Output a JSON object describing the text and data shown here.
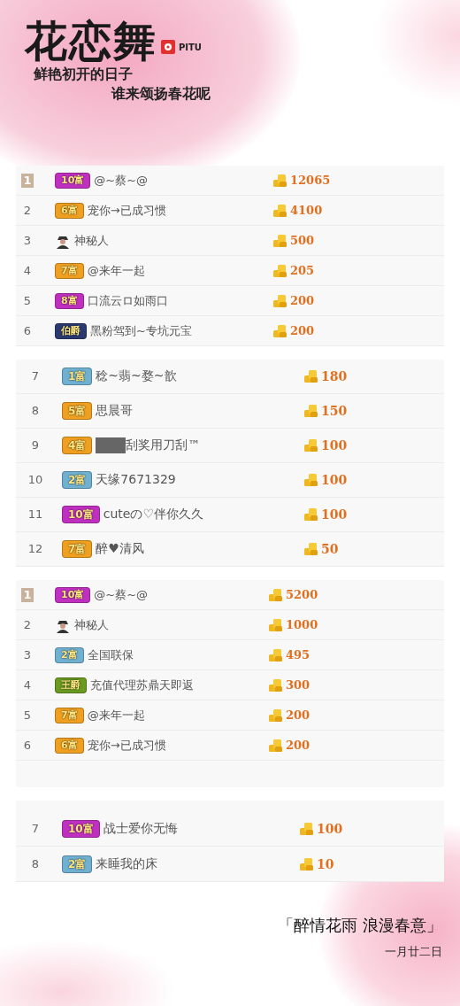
{
  "header": {
    "title": "花恋舞",
    "brand": "PITU",
    "subtitle_lines": [
      "鲜艳初开的日子",
      "谁来颂扬春花呢"
    ]
  },
  "panels": [
    {
      "rows": [
        {
          "rank": "1",
          "top": true,
          "kind": "badge",
          "badge": "10富",
          "color": "#c030c0",
          "redacted": false,
          "name": "@~蔡~@",
          "amount": "12065"
        },
        {
          "rank": "2",
          "top": false,
          "kind": "badge",
          "badge": "6富",
          "color": "#f0a020",
          "redacted": false,
          "name": "宠你→已成习惯",
          "amount": "4100"
        },
        {
          "rank": "3",
          "top": false,
          "kind": "anonymous",
          "redacted": false,
          "name": "神秘人",
          "amount": "500"
        },
        {
          "rank": "4",
          "top": false,
          "kind": "badge",
          "badge": "7富",
          "color": "#f0a020",
          "redacted": false,
          "name": "@来年一起",
          "amount": "205"
        },
        {
          "rank": "5",
          "top": false,
          "kind": "badge",
          "badge": "8富",
          "color": "#c030c0",
          "redacted": false,
          "name": "口流云ロ如雨口",
          "amount": "200"
        },
        {
          "rank": "6",
          "top": false,
          "kind": "badge",
          "badge": "伯爵",
          "color": "#2a3a70",
          "redacted": false,
          "name": "黑粉驾到~专坑元宝",
          "amount": "200"
        }
      ]
    },
    {
      "rows": [
        {
          "rank": "7",
          "top": false,
          "kind": "badge",
          "badge": "1富",
          "color": "#70b0d0",
          "redacted": false,
          "name": "稔~翡~婺~歆",
          "amount": "180"
        },
        {
          "rank": "8",
          "top": false,
          "kind": "badge",
          "badge": "5富",
          "color": "#f0a020",
          "redacted": false,
          "name": "思晨哥",
          "amount": "150"
        },
        {
          "rank": "9",
          "top": false,
          "kind": "badge",
          "badge": "4富",
          "color": "#f0a020",
          "redacted": true,
          "name": "刮奖用刀刮™",
          "amount": "100"
        },
        {
          "rank": "10",
          "top": false,
          "kind": "badge",
          "badge": "2富",
          "color": "#70b0d0",
          "redacted": false,
          "name": "天缘7671329",
          "amount": "100"
        },
        {
          "rank": "11",
          "top": false,
          "kind": "badge",
          "badge": "10富",
          "color": "#c030c0",
          "redacted": false,
          "name": "cuteの♡伴你久久",
          "amount": "100"
        },
        {
          "rank": "12",
          "top": false,
          "kind": "badge",
          "badge": "7富",
          "color": "#f0a020",
          "redacted": false,
          "name": "醉♥清风",
          "amount": "50"
        }
      ]
    },
    {
      "rows": [
        {
          "rank": "1",
          "top": true,
          "kind": "badge",
          "badge": "10富",
          "color": "#c030c0",
          "redacted": false,
          "name": "@~蔡~@",
          "amount": "5200"
        },
        {
          "rank": "2",
          "top": false,
          "kind": "anonymous",
          "redacted": false,
          "name": "神秘人",
          "amount": "1000"
        },
        {
          "rank": "3",
          "top": false,
          "kind": "badge",
          "badge": "2富",
          "color": "#70b0d0",
          "redacted": false,
          "name": "全国联保",
          "amount": "495"
        },
        {
          "rank": "4",
          "top": false,
          "kind": "badge",
          "badge": "王爵",
          "color": "#6a9a20",
          "redacted": false,
          "name": "充值代理苏鼎天即返",
          "amount": "300"
        },
        {
          "rank": "5",
          "top": false,
          "kind": "badge",
          "badge": "7富",
          "color": "#f0a020",
          "redacted": false,
          "name": "@来年一起",
          "amount": "200"
        },
        {
          "rank": "6",
          "top": false,
          "kind": "badge",
          "badge": "6富",
          "color": "#f0a020",
          "redacted": false,
          "name": "宠你→已成习惯",
          "amount": "200"
        }
      ]
    },
    {
      "rows": [
        {
          "rank": "7",
          "top": false,
          "kind": "badge",
          "badge": "10富",
          "color": "#c030c0",
          "redacted": false,
          "name": "战士爱你无悔",
          "amount": "100"
        },
        {
          "rank": "8",
          "top": false,
          "kind": "badge",
          "badge": "2富",
          "color": "#70b0d0",
          "redacted": false,
          "name": "来睡我的床",
          "amount": "10"
        }
      ]
    }
  ],
  "footer": {
    "quote": "「醉情花雨 浪漫春意」",
    "date": "一月廿二日"
  }
}
